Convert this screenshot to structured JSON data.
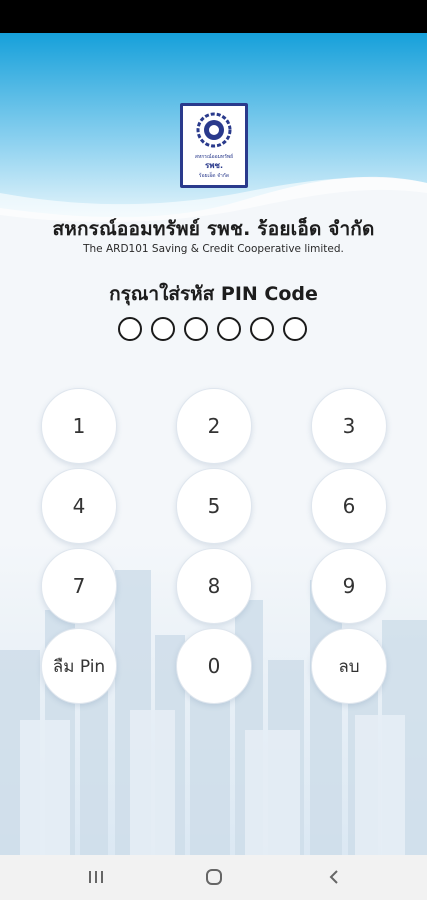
{
  "header": {
    "org_name_th": "สหกรณ์ออมทรัพย์ รพช. ร้อยเอ็ด จำกัด",
    "org_name_en": "The ARD101 Saving & Credit Cooperative limited.",
    "logo_text_line1": "สหกรณ์ออมทรัพย์",
    "logo_text_line2": "รพช.",
    "logo_text_line3": "ร้อยเอ็ด จำกัด"
  },
  "pin": {
    "prompt": "กรุณาใส่รหัส PIN Code",
    "length": 6,
    "entered": 0
  },
  "keypad": {
    "k1": "1",
    "k2": "2",
    "k3": "3",
    "k4": "4",
    "k5": "5",
    "k6": "6",
    "k7": "7",
    "k8": "8",
    "k9": "9",
    "forgot": "ลืม Pin",
    "k0": "0",
    "delete": "ลบ"
  },
  "nav": {
    "recents_icon": "recents-icon",
    "home_icon": "home-icon",
    "back_icon": "back-icon"
  },
  "colors": {
    "wave_top": "#1aa0d8",
    "wave_bottom": "#d4eef9",
    "logo_border": "#2a3a8c"
  }
}
